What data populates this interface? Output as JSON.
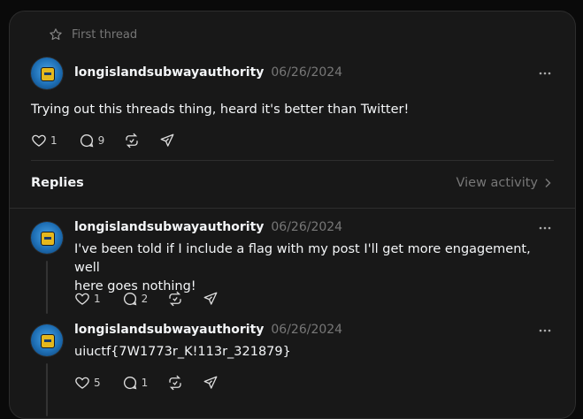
{
  "header": {
    "first_thread_label": "First thread"
  },
  "main_post": {
    "username": "longislandsubwayauthority",
    "date": "06/26/2024",
    "text": "Trying out this threads thing, heard it's better than Twitter!",
    "likes": "1",
    "comments": "9"
  },
  "replies_section": {
    "title": "Replies",
    "view_activity": "View activity"
  },
  "replies": [
    {
      "username": "longislandsubwayauthority",
      "date": "06/26/2024",
      "text_line1": "I've been told if I include a flag with my post I'll get more engagement, well",
      "text_line2": "here goes nothing!",
      "likes": "1",
      "comments": "2"
    },
    {
      "username": "longislandsubwayauthority",
      "date": "06/26/2024",
      "text": "uiuctf{7W1773r_K!113r_321879}",
      "likes": "5",
      "comments": "1"
    }
  ],
  "icons": [
    "star-icon",
    "more-icon",
    "heart-icon",
    "comment-icon",
    "repost-icon",
    "share-icon",
    "chevron-right-icon"
  ],
  "colors": {
    "background": "#0a0a0a",
    "card": "#181818",
    "muted": "#777777",
    "text": "#f3f5f7"
  }
}
